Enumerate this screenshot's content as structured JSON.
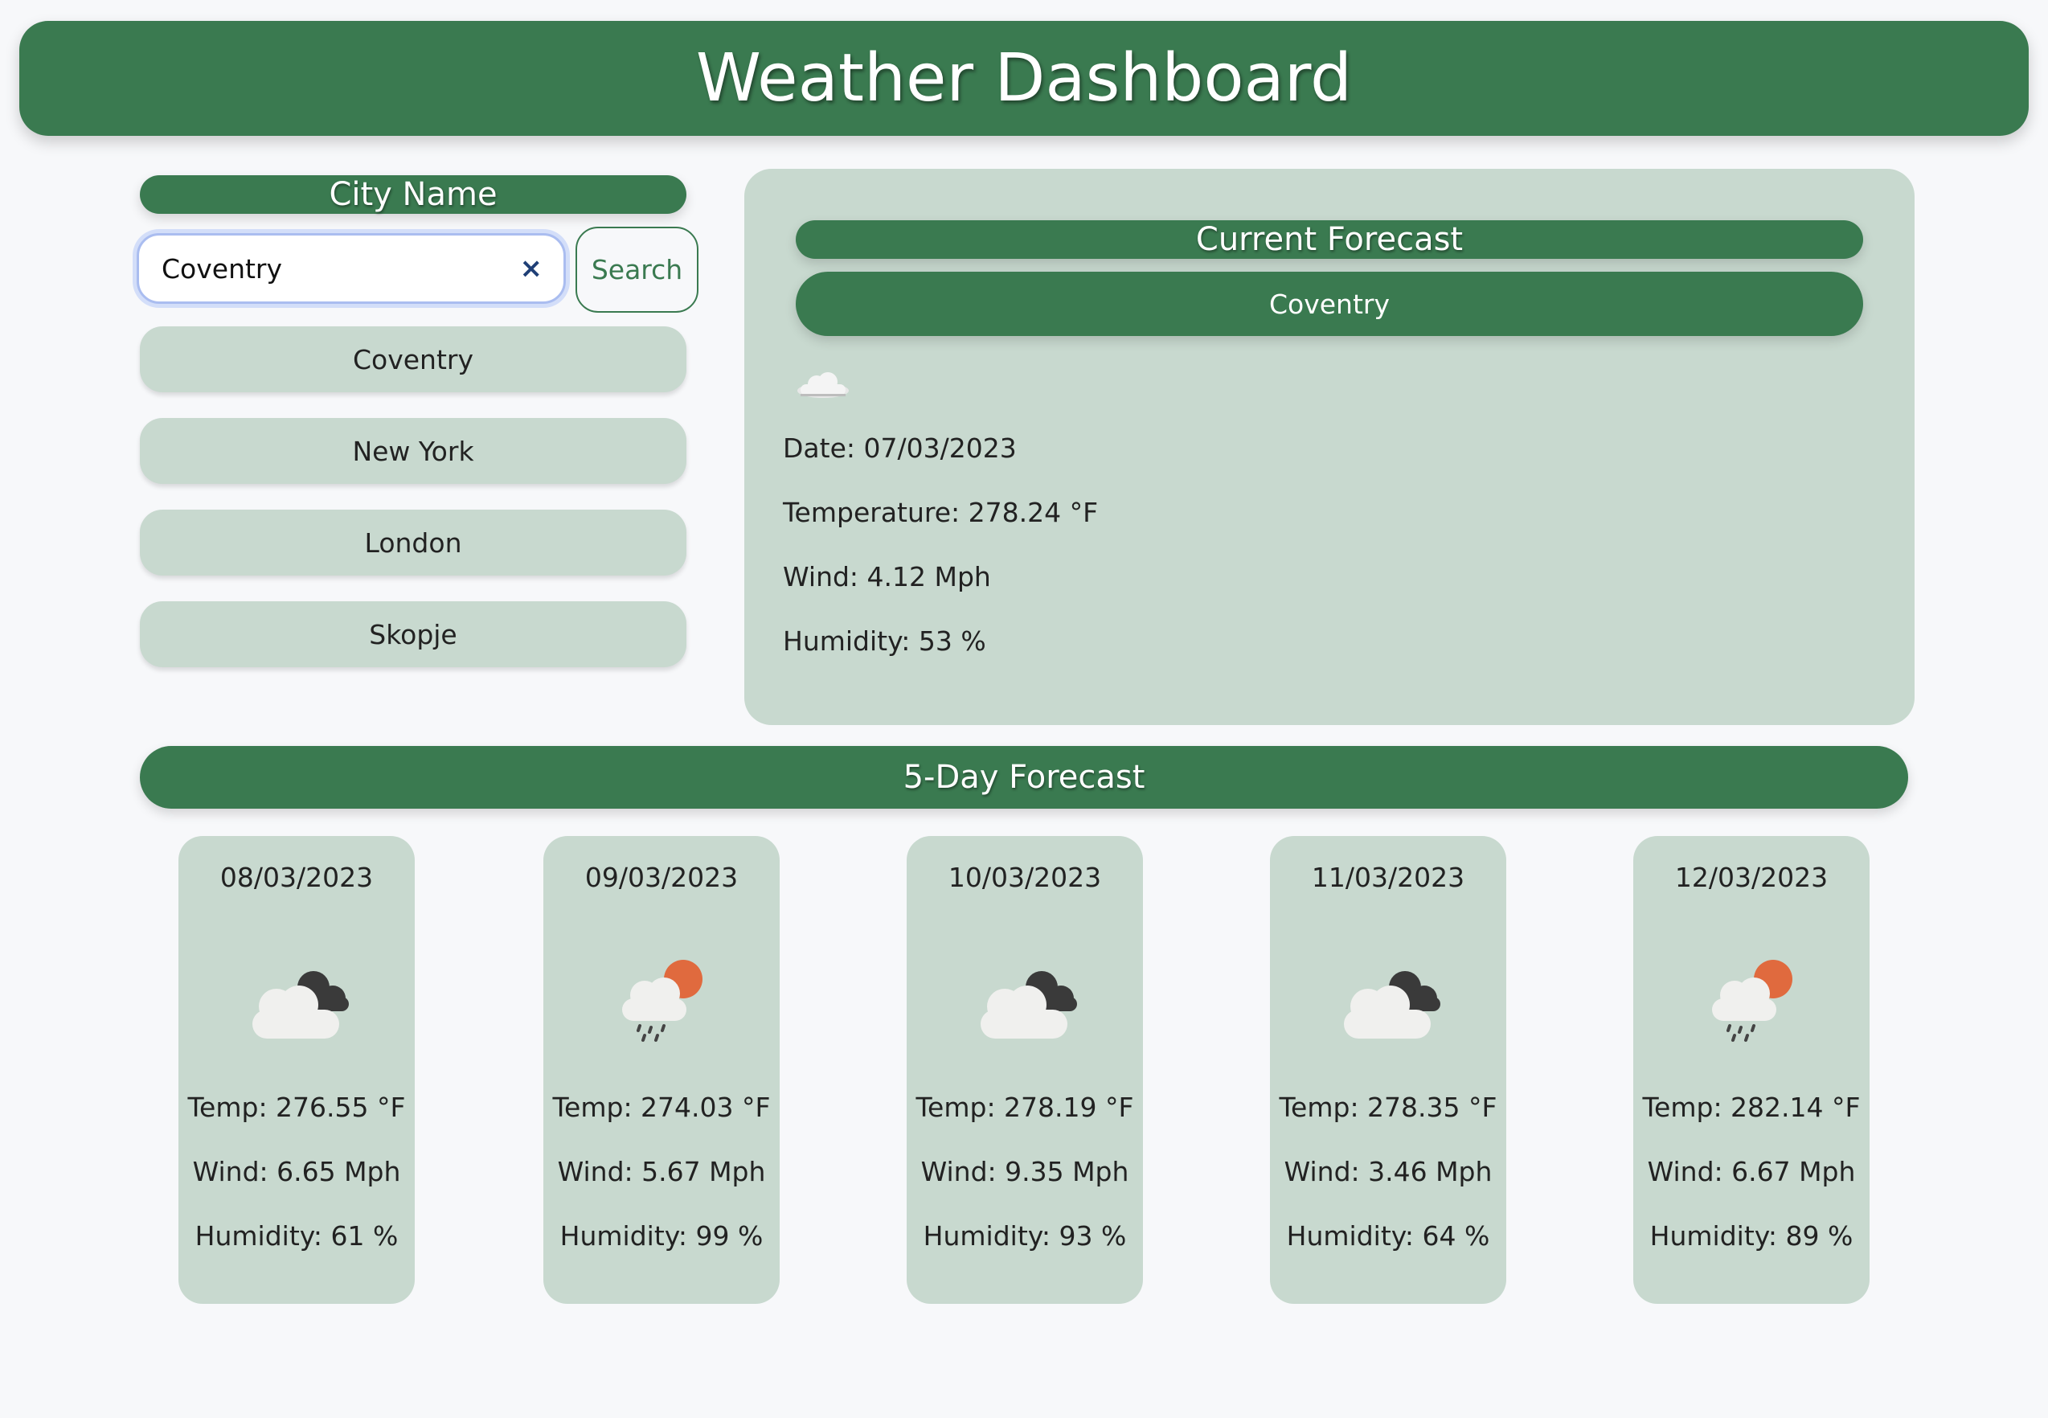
{
  "header": {
    "title": "Weather Dashboard"
  },
  "sidebar": {
    "title": "City Name",
    "search_value": "Coventry",
    "clear_symbol": "×",
    "search_label": "Search",
    "history": [
      "Coventry",
      "New York",
      "London",
      "Skopje"
    ]
  },
  "current": {
    "title": "Current Forecast",
    "city": "Coventry",
    "icon": "cloud-icon",
    "date": "Date: 07/03/2023",
    "temp": "Temperature: 278.24 °F",
    "wind": "Wind: 4.12 Mph",
    "humidity": "Humidity: 53 %"
  },
  "forecast": {
    "title": "5-Day Forecast",
    "days": [
      {
        "date": "08/03/2023",
        "icon": "broken-clouds-icon",
        "temp": "Temp: 276.55 °F",
        "wind": "Wind: 6.65 Mph",
        "humidity": "Humidity: 61 %"
      },
      {
        "date": "09/03/2023",
        "icon": "rain-sun-icon",
        "temp": "Temp: 274.03 °F",
        "wind": "Wind: 5.67 Mph",
        "humidity": "Humidity: 99 %"
      },
      {
        "date": "10/03/2023",
        "icon": "broken-clouds-icon",
        "temp": "Temp: 278.19 °F",
        "wind": "Wind: 9.35 Mph",
        "humidity": "Humidity: 93 %"
      },
      {
        "date": "11/03/2023",
        "icon": "broken-clouds-icon",
        "temp": "Temp: 278.35 °F",
        "wind": "Wind: 3.46 Mph",
        "humidity": "Humidity: 64 %"
      },
      {
        "date": "12/03/2023",
        "icon": "rain-sun-icon",
        "temp": "Temp: 282.14 °F",
        "wind": "Wind: 6.67 Mph",
        "humidity": "Humidity: 89 %"
      }
    ]
  },
  "colors": {
    "primary": "#3a7a50",
    "panel": "#c8d9cf",
    "background": "#f7f8fa"
  }
}
